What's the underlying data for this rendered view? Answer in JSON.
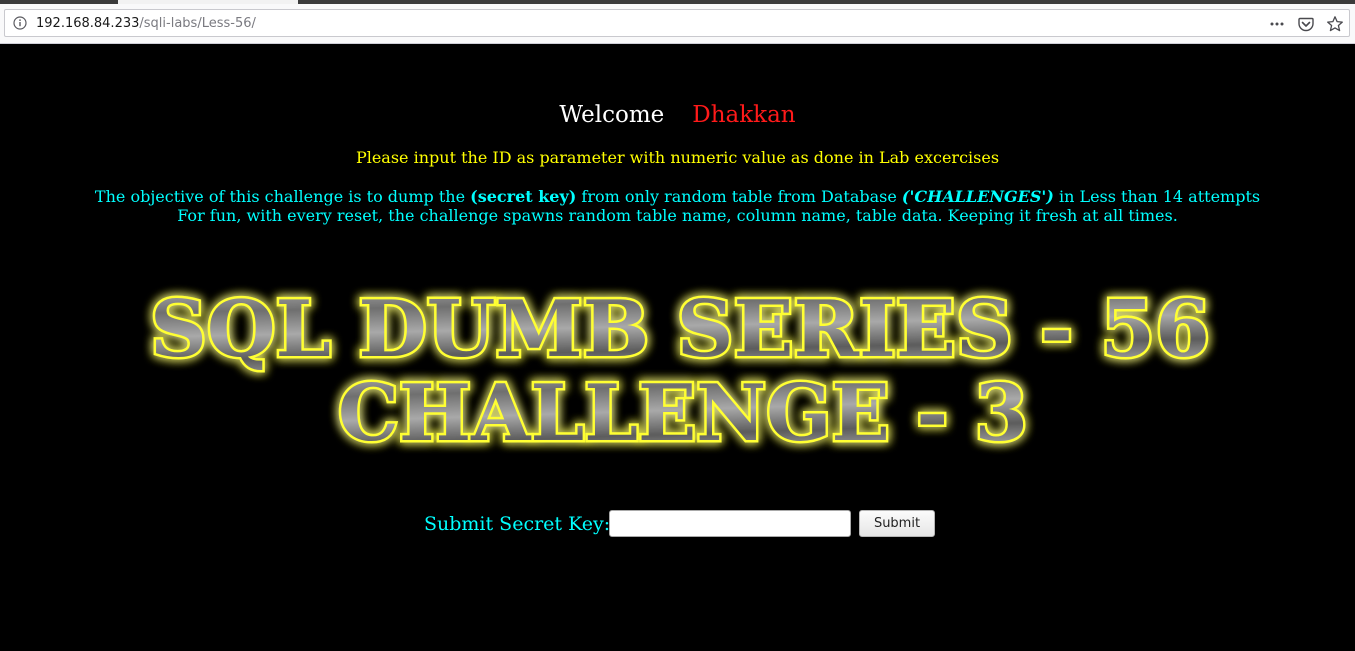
{
  "browser": {
    "url_host": "192.168.84.233",
    "url_path": "/sqli-labs/Less-56/",
    "icons": [
      "info-icon",
      "more-icon",
      "pocket-icon",
      "bookmark-star-icon"
    ]
  },
  "page": {
    "welcome_word": "Welcome",
    "welcome_name": "Dhakkan",
    "instructions": "Please input the ID as parameter with numeric value as done in Lab excercises",
    "objective": {
      "part1": "The objective of this challenge is to dump the ",
      "secret_key": "(secret key)",
      "part2": " from only random table from Database ",
      "database": "('CHALLENGES')",
      "part3": " in Less than 14 attempts",
      "line2": "For fun, with every reset, the challenge spawns random table name, column name, table data. Keeping it fresh at all times."
    },
    "banner": {
      "line1": "SQL DUMB SERIES - 56",
      "line2": "CHALLENGE - 3"
    },
    "form": {
      "label": "Submit Secret Key:",
      "input_value": "",
      "button_label": "Submit"
    }
  },
  "colors": {
    "background": "#000000",
    "welcome": "#ffffff",
    "name": "#ff1a1a",
    "instructions": "#ffff00",
    "objective": "#00ffff",
    "banner_glow": "#ffff00"
  }
}
